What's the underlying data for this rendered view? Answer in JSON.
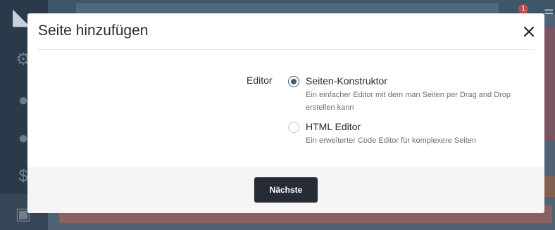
{
  "modal": {
    "title": "Seite hinzufügen",
    "close_icon": "close-icon",
    "editor_label": "Editor",
    "options": [
      {
        "label": "Seiten-Konstruktor",
        "description": "Ein einfacher Editor mit dem man Seiten per Drag and Drop erstellen kann",
        "selected": true
      },
      {
        "label": "HTML Editor",
        "description": "Ein erweiterter Code Editor für komplexere Seiten",
        "selected": false
      }
    ],
    "next_button": "Nächste"
  },
  "background": {
    "notification_count": "1",
    "icons": [
      "logo-icon",
      "gear-icon",
      "chat-icon",
      "user-icon",
      "dollar-icon",
      "box-icon",
      "menu-icon"
    ]
  },
  "colors": {
    "accent_radio": "#3f5f7a",
    "primary_button": "#262c33",
    "footer_bg": "#f5f5f5"
  }
}
